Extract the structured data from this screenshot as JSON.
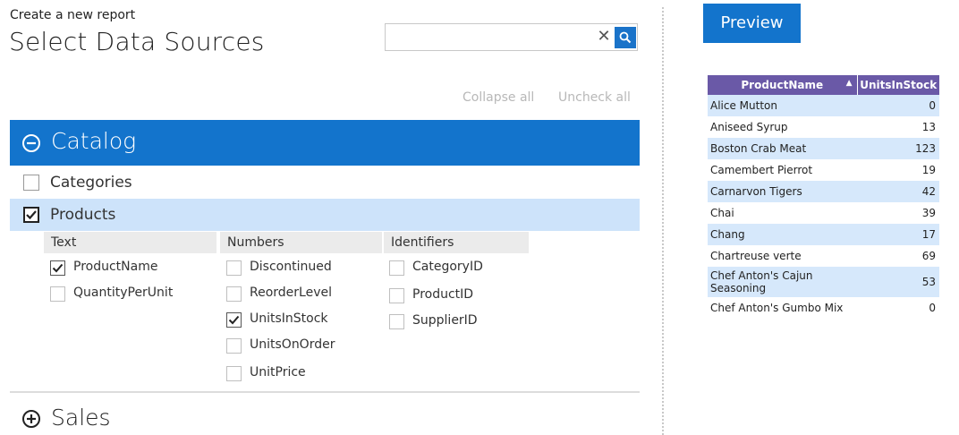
{
  "header": {
    "subtitle": "Create a new report",
    "title": "Select Data Sources"
  },
  "search": {
    "value": "",
    "placeholder": ""
  },
  "links": {
    "collapse_all": "Collapse all",
    "uncheck_all": "Uncheck all"
  },
  "catalog": {
    "label": "Catalog",
    "expanded": true,
    "tables": [
      {
        "label": "Categories",
        "checked": false
      },
      {
        "label": "Products",
        "checked": true
      }
    ]
  },
  "products_groups": {
    "text": {
      "label": "Text",
      "fields": [
        {
          "label": "ProductName",
          "checked": true
        },
        {
          "label": "QuantityPerUnit",
          "checked": false
        }
      ]
    },
    "numbers": {
      "label": "Numbers",
      "fields": [
        {
          "label": "Discontinued",
          "checked": false
        },
        {
          "label": "ReorderLevel",
          "checked": false
        },
        {
          "label": "UnitsInStock",
          "checked": true
        },
        {
          "label": "UnitsOnOrder",
          "checked": false
        },
        {
          "label": "UnitPrice",
          "checked": false
        }
      ]
    },
    "identifiers": {
      "label": "Identifiers",
      "fields": [
        {
          "label": "CategoryID",
          "checked": false
        },
        {
          "label": "ProductID",
          "checked": false
        },
        {
          "label": "SupplierID",
          "checked": false
        }
      ]
    }
  },
  "sales": {
    "label": "Sales",
    "expanded": false
  },
  "preview": {
    "button_label": "Preview",
    "columns": [
      "ProductName",
      "UnitsInStock"
    ],
    "sort": {
      "column": "ProductName",
      "direction": "ascending"
    },
    "rows": [
      {
        "name": "Alice Mutton",
        "units": "0"
      },
      {
        "name": "Aniseed Syrup",
        "units": "13"
      },
      {
        "name": "Boston Crab Meat",
        "units": "123"
      },
      {
        "name": "Camembert Pierrot",
        "units": "19"
      },
      {
        "name": "Carnarvon Tigers",
        "units": "42"
      },
      {
        "name": "Chai",
        "units": "39"
      },
      {
        "name": "Chang",
        "units": "17"
      },
      {
        "name": "Chartreuse verte",
        "units": "69"
      },
      {
        "name": "Chef Anton's Cajun Seasoning",
        "units": "53"
      },
      {
        "name": "Chef Anton's Gumbo Mix",
        "units": "0"
      }
    ]
  },
  "colors": {
    "accent": "#1374cc",
    "selected_row": "#cde3fa",
    "table_header": "#6a59a7",
    "table_alt_row": "#d6e8fb"
  }
}
